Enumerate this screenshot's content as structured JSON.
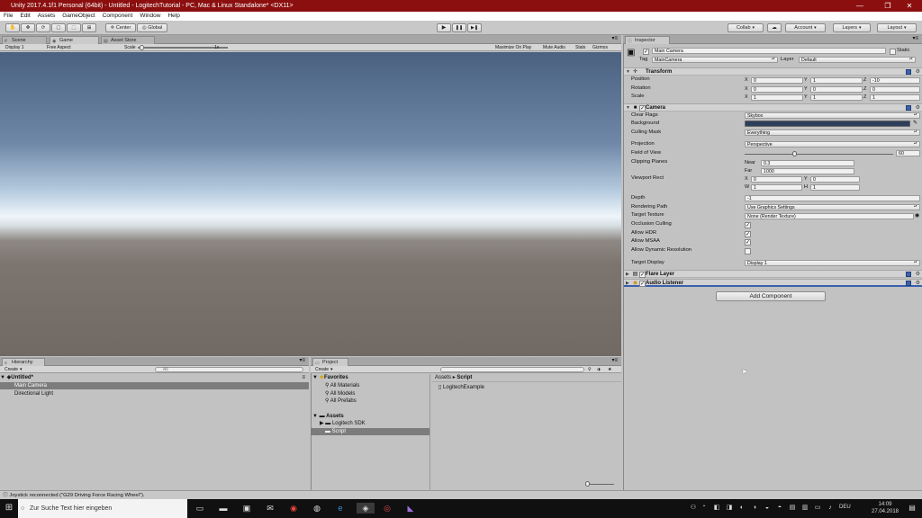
{
  "window": {
    "title": "Unity 2017.4.1f1 Personal (64bit) - Untitled - LogitechTutorial - PC, Mac & Linux Standalone* <DX11>",
    "minimize": "—",
    "maximize": "❐",
    "close": "✕"
  },
  "menu": [
    "File",
    "Edit",
    "Assets",
    "GameObject",
    "Component",
    "Window",
    "Help"
  ],
  "toolbar": {
    "pivot_label": "Center",
    "space_label": "Global",
    "play": "▶",
    "pause": "❚❚",
    "step": "▶❚",
    "collab_label": "Collab",
    "cloud_icon": "☁",
    "account_label": "Account",
    "layers_label": "Layers",
    "layout_label": "Layout",
    "tools": [
      "✋",
      "✥",
      "⟳",
      "▢",
      "⬚",
      "⊞"
    ]
  },
  "scene_tabs": [
    {
      "label": "Scene",
      "icon": "#"
    },
    {
      "label": "Game",
      "icon": "◉"
    },
    {
      "label": "Asset Store",
      "icon": "▤"
    }
  ],
  "game_bar": {
    "display": "Display 1",
    "aspect": "Free Aspect",
    "scale_label": "Scale",
    "scale_value": "1x",
    "buttons": [
      "Maximize On Play",
      "Mute Audio",
      "Stats",
      "Gizmos"
    ]
  },
  "inspector": {
    "tab_label": "Inspector",
    "object_name": "Main Camera",
    "static_label": "Static",
    "tag_label": "Tag",
    "tag_value": "MainCamera",
    "layer_label": "Layer",
    "layer_value": "Default",
    "transform": {
      "title": "Transform",
      "rows": [
        {
          "label": "Position",
          "x": "0",
          "y": "1",
          "z": "-10"
        },
        {
          "label": "Rotation",
          "x": "0",
          "y": "0",
          "z": "0"
        },
        {
          "label": "Scale",
          "x": "1",
          "y": "1",
          "z": "1"
        }
      ]
    },
    "camera": {
      "title": "Camera",
      "clear_flags_label": "Clear Flags",
      "clear_flags": "Skybox",
      "background_label": "Background",
      "background_color": "#2c3f5c",
      "culling_mask_label": "Culling Mask",
      "culling_mask": "Everything",
      "projection_label": "Projection",
      "projection": "Perspective",
      "fov_label": "Field of View",
      "fov": "60",
      "fov_fraction": 0.33,
      "clipping_label": "Clipping Planes",
      "near_label": "Near",
      "near": "0.3",
      "far_label": "Far",
      "far": "1000",
      "viewport_label": "Viewport Rect",
      "vx": "0",
      "vy": "0",
      "vw": "1",
      "vh": "1",
      "depth_label": "Depth",
      "depth": "-1",
      "rendering_path_label": "Rendering Path",
      "rendering_path": "Use Graphics Settings",
      "target_texture_label": "Target Texture",
      "target_texture": "None (Render Texture)",
      "occlusion_label": "Occlusion Culling",
      "hdr_label": "Allow HDR",
      "msaa_label": "Allow MSAA",
      "dynres_label": "Allow Dynamic Resolution",
      "target_display_label": "Target Display",
      "target_display": "Display 1"
    },
    "flare_layer": "Flare Layer",
    "audio_listener": "Audio Listener",
    "add_component": "Add Component"
  },
  "hierarchy": {
    "tab_label": "Hierarchy",
    "create_label": "Create",
    "search_placeholder": "All",
    "scene": "Untitled*",
    "items": [
      "Main Camera",
      "Directional Light"
    ]
  },
  "project": {
    "tab_label": "Project",
    "create_label": "Create",
    "favorites_label": "Favorites",
    "favorites": [
      "All Materials",
      "All Models",
      "All Prefabs"
    ],
    "assets_label": "Assets",
    "folders": [
      "Logitech SDK",
      "Script"
    ],
    "breadcrumb_root": "Assets",
    "breadcrumb_sep": "▸",
    "breadcrumb_current": "Script",
    "files": [
      "LogitechExample"
    ]
  },
  "status_text": "Joystick reconnected (\"G29 Driving Force Racing Wheel\").",
  "taskbar": {
    "search_placeholder": "Zur Suche Text hier eingeben",
    "lang": "DEU",
    "time": "14:09",
    "date": "27.04.2018"
  }
}
